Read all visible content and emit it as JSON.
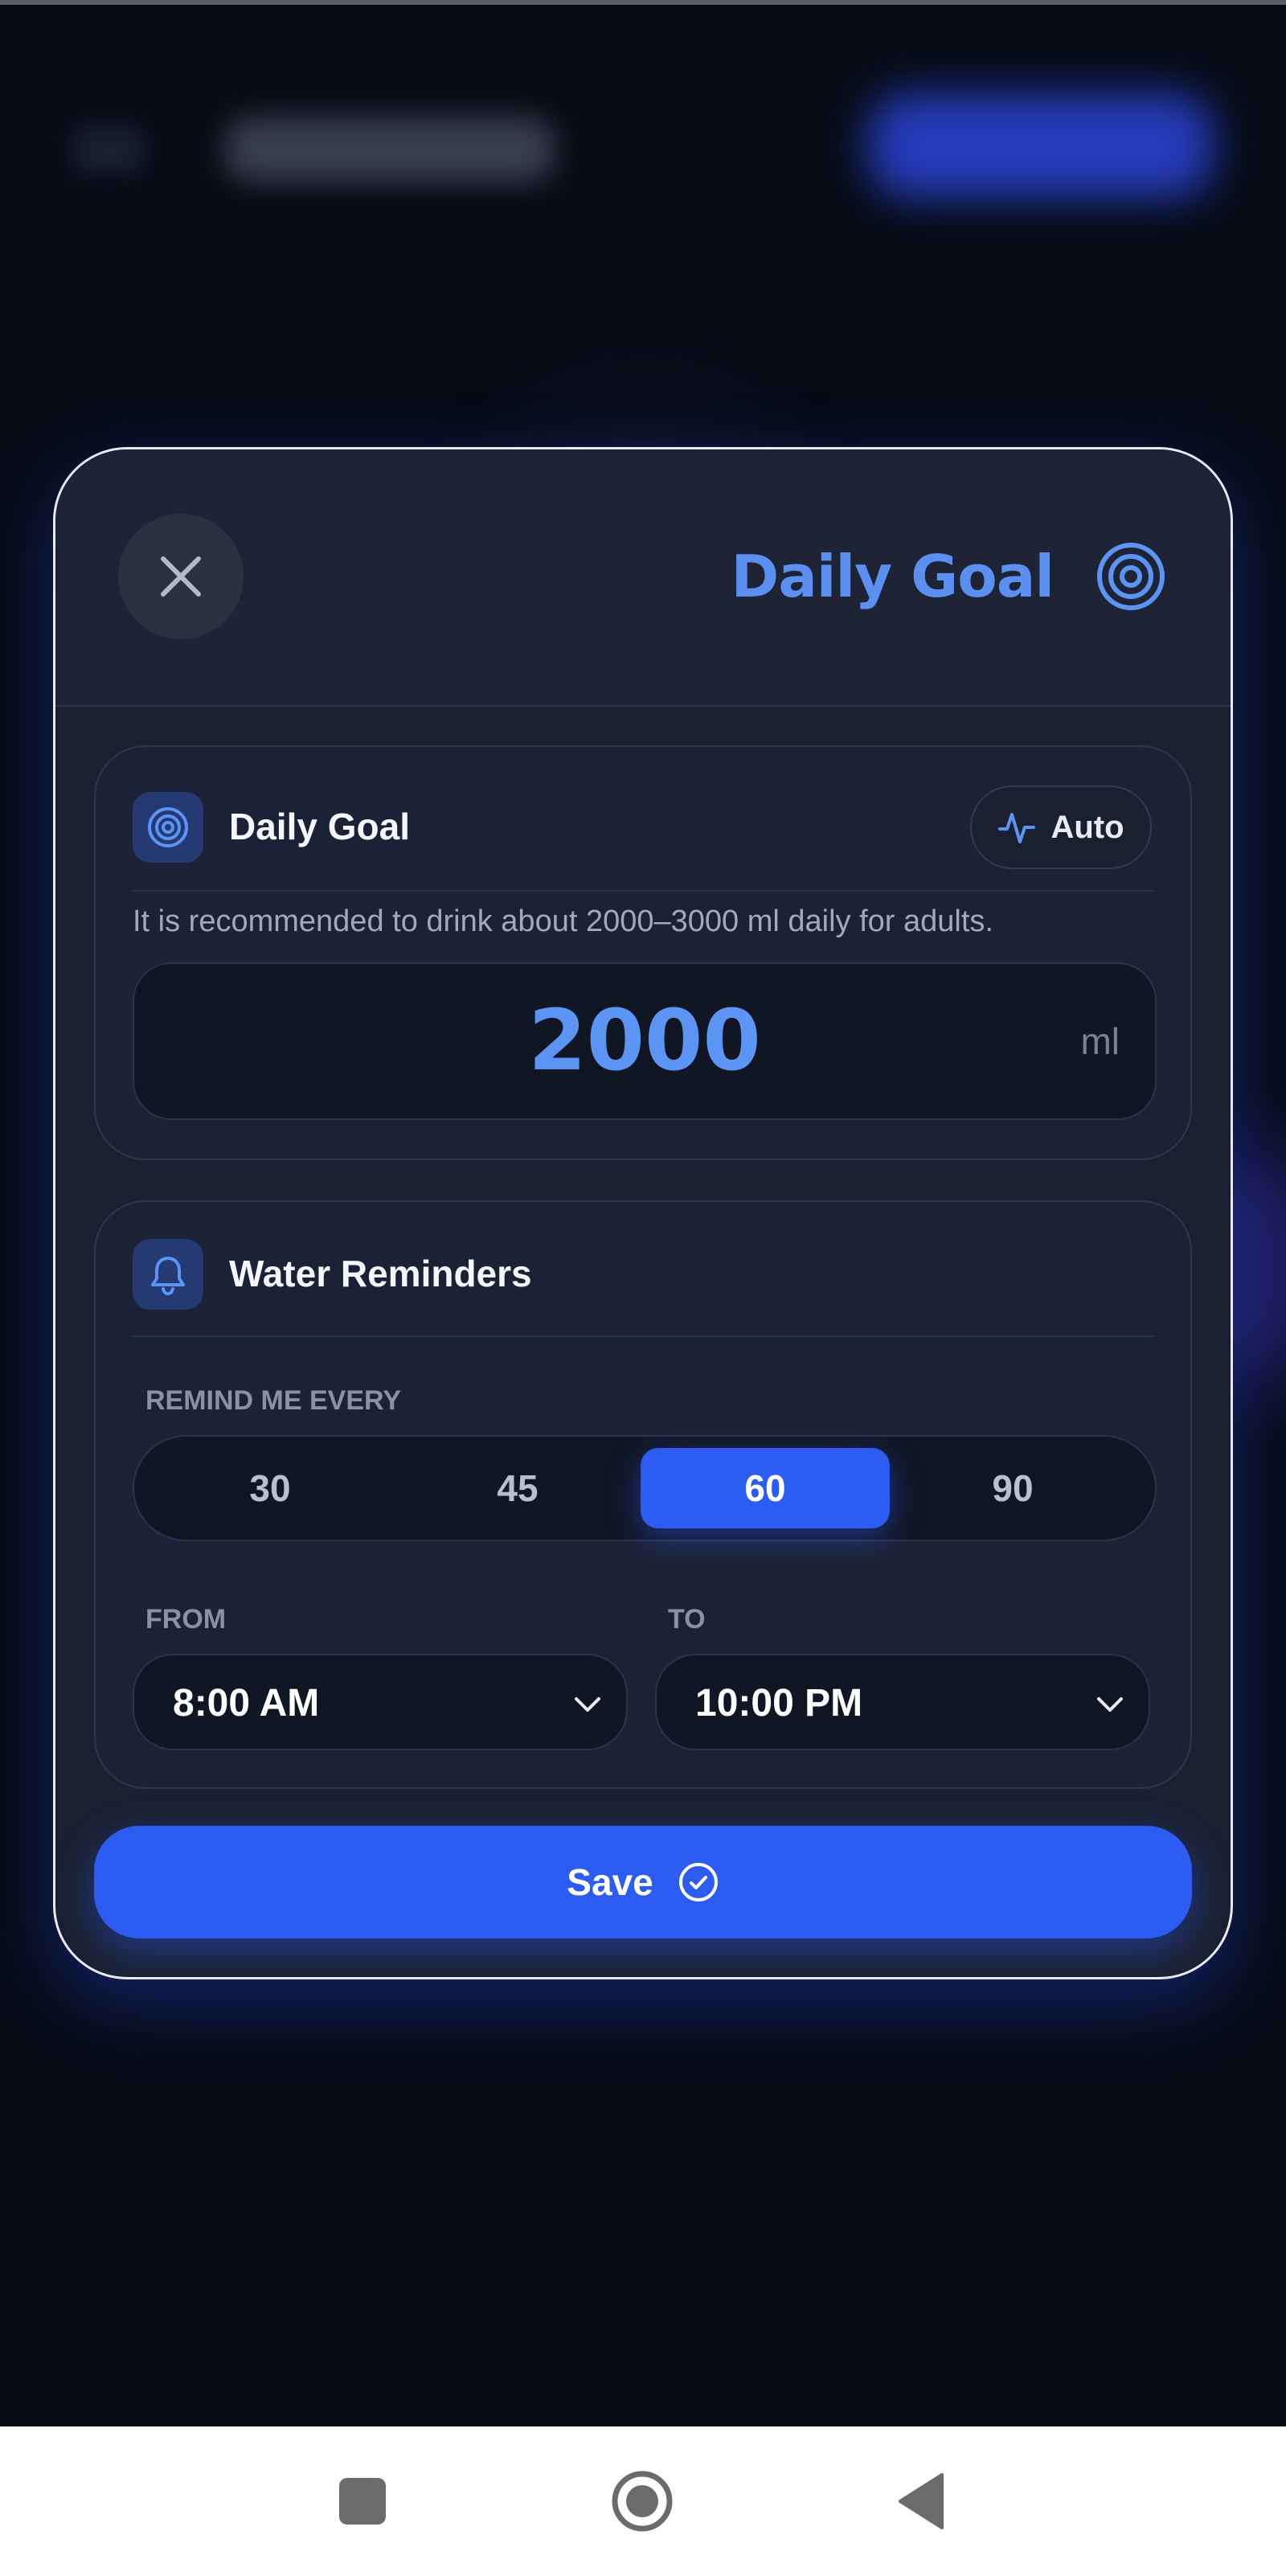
{
  "colors": {
    "accent": "#2d5cf2",
    "accent_text": "#5b94f2",
    "background": "#070b16",
    "card": "#1c2235"
  },
  "modal": {
    "title": "Daily Goal",
    "title_icon": "target-icon",
    "close_icon": "close-icon"
  },
  "goal_card": {
    "title": "Daily Goal",
    "icon": "target-icon",
    "auto_label": "Auto",
    "auto_icon": "activity-icon",
    "description": "It is recommended to drink about 2000–3000 ml daily for adults.",
    "value": "2000",
    "unit": "ml"
  },
  "reminders_card": {
    "title": "Water Reminders",
    "icon": "bell-icon",
    "interval_label": "REMIND ME EVERY",
    "intervals": [
      "30",
      "45",
      "60",
      "90"
    ],
    "selected_interval": "60",
    "from_label": "FROM",
    "from_value": "8:00 AM",
    "to_label": "TO",
    "to_value": "10:00 PM"
  },
  "save": {
    "label": "Save",
    "icon": "check-circle-icon"
  },
  "navbar": {
    "recents_icon": "recents-icon",
    "home_icon": "home-icon",
    "back_icon": "back-icon"
  }
}
